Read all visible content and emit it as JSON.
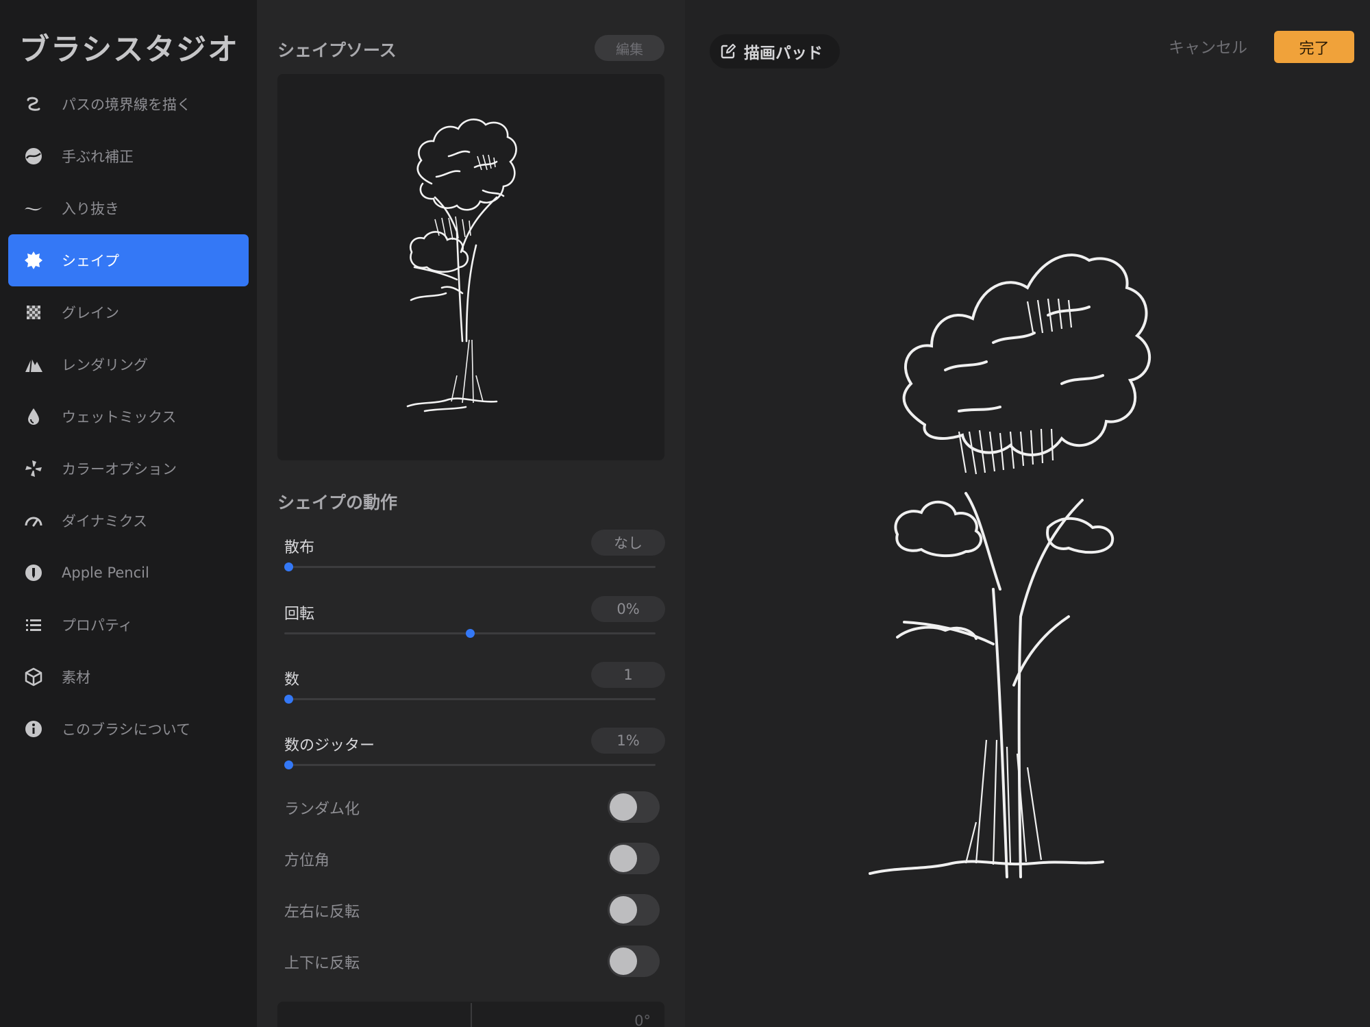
{
  "sidebar": {
    "title": "ブラシスタジオ",
    "items": [
      {
        "label": "パスの境界線を描く",
        "icon": "stroke-path-icon"
      },
      {
        "label": "手ぶれ補正",
        "icon": "stabilization-icon"
      },
      {
        "label": "入り抜き",
        "icon": "taper-icon"
      },
      {
        "label": "シェイプ",
        "icon": "shape-icon"
      },
      {
        "label": "グレイン",
        "icon": "grain-icon"
      },
      {
        "label": "レンダリング",
        "icon": "rendering-icon"
      },
      {
        "label": "ウェットミックス",
        "icon": "wet-mix-icon"
      },
      {
        "label": "カラーオプション",
        "icon": "color-options-icon"
      },
      {
        "label": "ダイナミクス",
        "icon": "dynamics-icon"
      },
      {
        "label": "Apple Pencil",
        "icon": "apple-pencil-icon"
      },
      {
        "label": "プロパティ",
        "icon": "properties-icon"
      },
      {
        "label": "素材",
        "icon": "materials-icon"
      },
      {
        "label": "このブラシについて",
        "icon": "info-icon"
      }
    ],
    "active_index": 3
  },
  "panel": {
    "shape_source_title": "シェイプソース",
    "edit_label": "編集",
    "shape_behavior_title": "シェイプの動作",
    "sliders": [
      {
        "label": "散布",
        "value": "なし",
        "position": 0.0
      },
      {
        "label": "回転",
        "value": "0%",
        "position": 0.5
      },
      {
        "label": "数",
        "value": "1",
        "position": 0.0
      },
      {
        "label": "数のジッター",
        "value": "1%",
        "position": 0.0
      }
    ],
    "toggles": [
      {
        "label": "ランダム化",
        "on": false
      },
      {
        "label": "方位角",
        "on": false
      },
      {
        "label": "左右に反転",
        "on": false
      },
      {
        "label": "上下に反転",
        "on": false
      }
    ],
    "bottom_value": "0°"
  },
  "pad": {
    "tab_label": "描画パッド",
    "cancel_label": "キャンセル",
    "done_label": "完了"
  },
  "colors": {
    "accent": "#3478f6",
    "done": "#f0a23a"
  }
}
